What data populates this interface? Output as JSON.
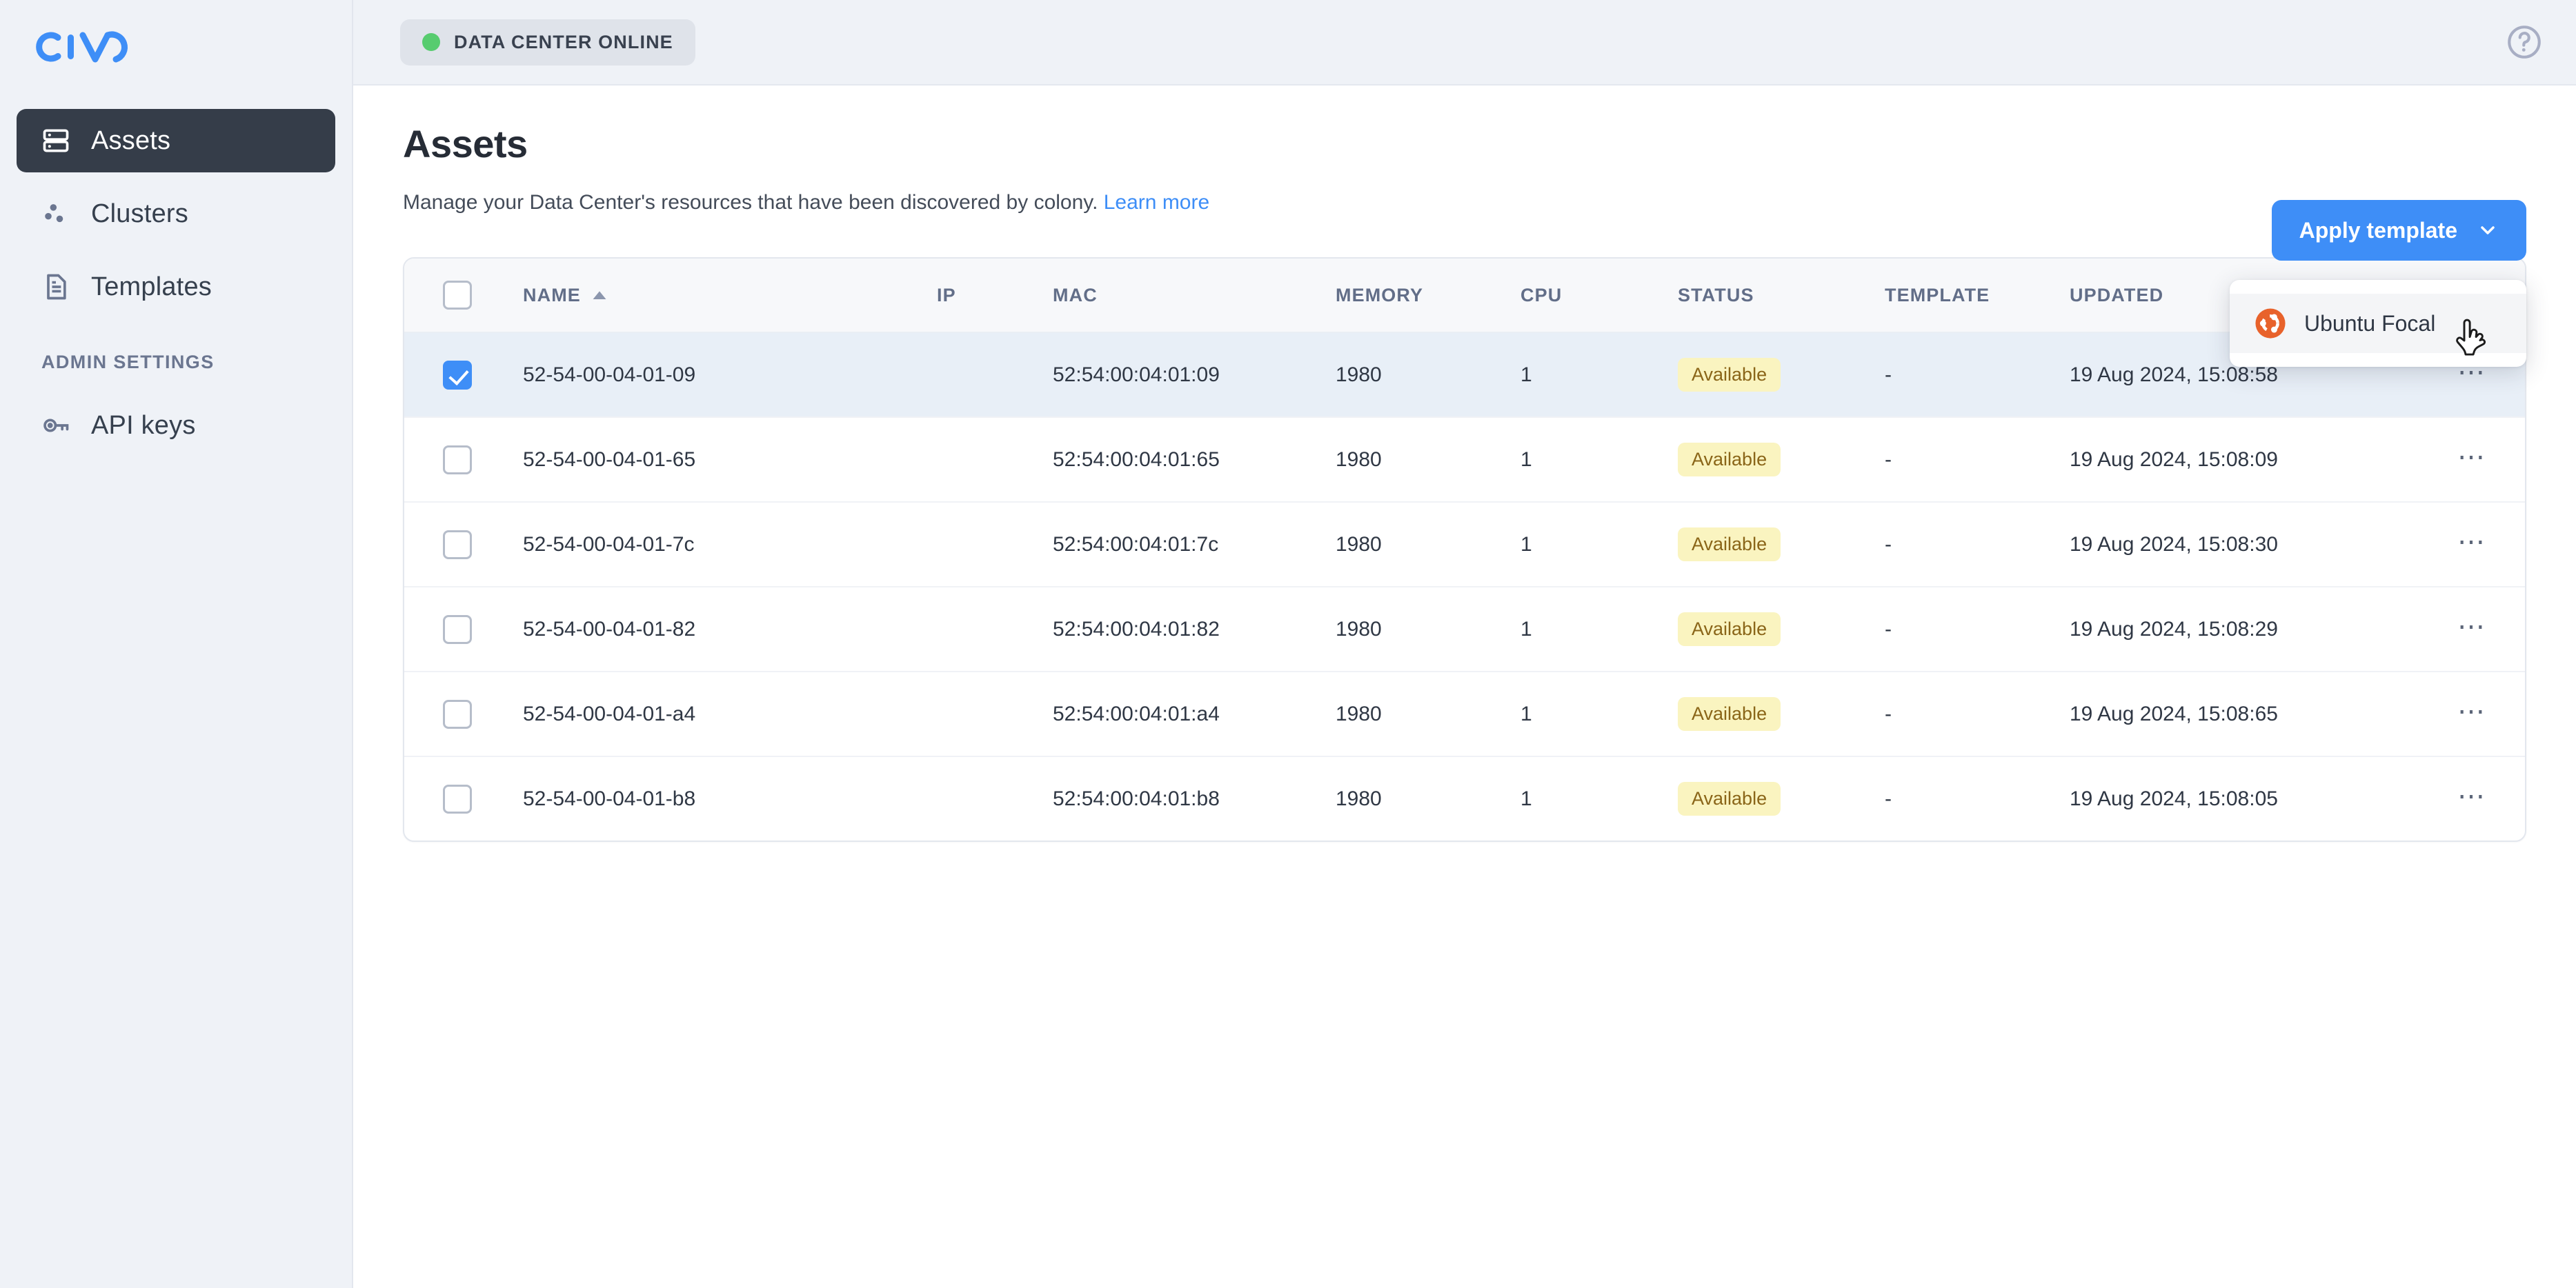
{
  "brand": {
    "logo_text": "CIVO",
    "accent_color": "#3e8ef7"
  },
  "sidebar": {
    "items": [
      {
        "label": "Assets",
        "icon": "server-rack-icon",
        "active": true
      },
      {
        "label": "Clusters",
        "icon": "cluster-dots-icon",
        "active": false
      },
      {
        "label": "Templates",
        "icon": "document-icon",
        "active": false
      }
    ],
    "section_title": "ADMIN SETTINGS",
    "admin_items": [
      {
        "label": "API keys",
        "icon": "key-icon",
        "active": false
      }
    ]
  },
  "topbar": {
    "status_badge": {
      "label": "DATA CENTER ONLINE",
      "dot_color": "#57cc6f"
    },
    "help_icon": "help-circle-icon"
  },
  "page": {
    "title": "Assets",
    "description": "Manage your Data Center's resources that have been discovered by colony.",
    "learn_more": "Learn more"
  },
  "apply_template": {
    "label": "Apply template",
    "chevron_icon": "chevron-down-icon",
    "open": true,
    "options": [
      {
        "label": "Ubuntu Focal",
        "icon": "ubuntu-icon",
        "icon_color": "#e8622b",
        "hovered": true
      }
    ]
  },
  "table": {
    "sort": {
      "column": "NAME",
      "direction": "asc"
    },
    "header_checkbox_checked": false,
    "columns": [
      "NAME",
      "IP",
      "MAC",
      "MEMORY",
      "CPU",
      "STATUS",
      "TEMPLATE",
      "UPDATED"
    ],
    "rows": [
      {
        "selected": true,
        "name": "52-54-00-04-01-09",
        "ip": "",
        "mac": "52:54:00:04:01:09",
        "memory": "1980",
        "cpu": "1",
        "status": "Available",
        "template": "-",
        "updated": "19 Aug 2024, 15:08:58"
      },
      {
        "selected": false,
        "name": "52-54-00-04-01-65",
        "ip": "",
        "mac": "52:54:00:04:01:65",
        "memory": "1980",
        "cpu": "1",
        "status": "Available",
        "template": "-",
        "updated": "19 Aug 2024, 15:08:09"
      },
      {
        "selected": false,
        "name": "52-54-00-04-01-7c",
        "ip": "",
        "mac": "52:54:00:04:01:7c",
        "memory": "1980",
        "cpu": "1",
        "status": "Available",
        "template": "-",
        "updated": "19 Aug 2024, 15:08:30"
      },
      {
        "selected": false,
        "name": "52-54-00-04-01-82",
        "ip": "",
        "mac": "52:54:00:04:01:82",
        "memory": "1980",
        "cpu": "1",
        "status": "Available",
        "template": "-",
        "updated": "19 Aug 2024, 15:08:29"
      },
      {
        "selected": false,
        "name": "52-54-00-04-01-a4",
        "ip": "",
        "mac": "52:54:00:04:01:a4",
        "memory": "1980",
        "cpu": "1",
        "status": "Available",
        "template": "-",
        "updated": "19 Aug 2024, 15:08:65"
      },
      {
        "selected": false,
        "name": "52-54-00-04-01-b8",
        "ip": "",
        "mac": "52:54:00:04:01:b8",
        "memory": "1980",
        "cpu": "1",
        "status": "Available",
        "template": "-",
        "updated": "19 Aug 2024, 15:08:05"
      }
    ],
    "row_menu_icon": "kebab-menu-icon"
  }
}
